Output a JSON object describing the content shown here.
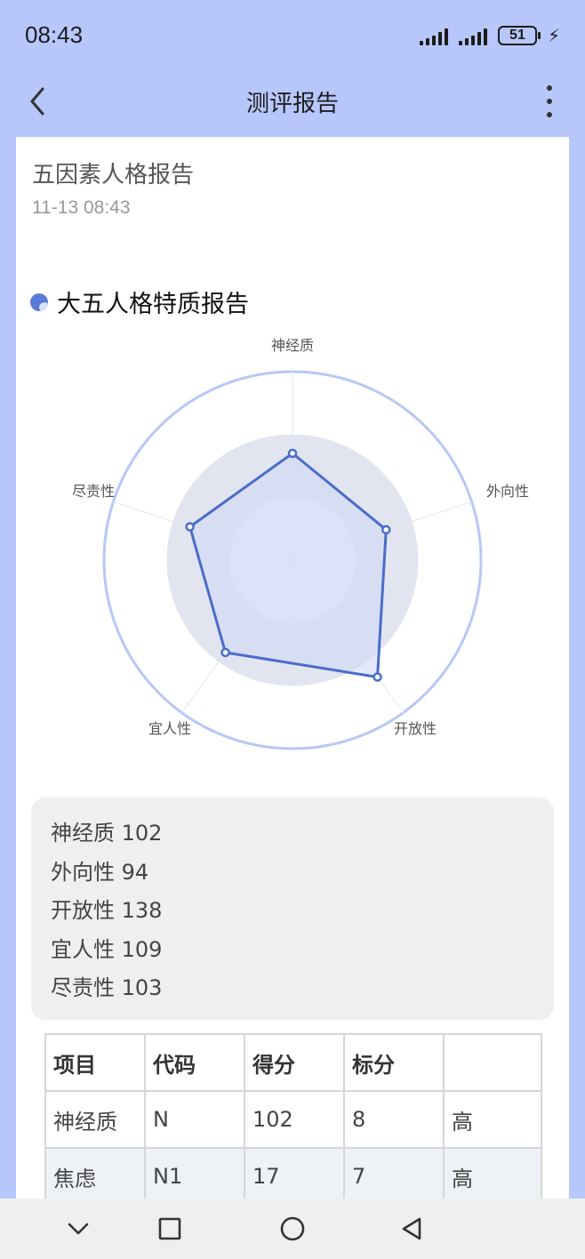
{
  "status_bar": {
    "time": "08:43",
    "battery": "51"
  },
  "app_bar": {
    "title": "测评报告"
  },
  "report": {
    "title": "五因素人格报告",
    "time": "11-13 08:43"
  },
  "section": {
    "title": "大五人格特质报告"
  },
  "chart_data": {
    "type": "radar",
    "indicators": [
      "神经质",
      "外向性",
      "开放性",
      "宜人性",
      "尽责性"
    ],
    "values": [
      102,
      94,
      138,
      109,
      103
    ],
    "colors": {
      "line": "#4a6dc8",
      "fill": "#cdd7f6",
      "outer_ring": "#b6c8f4"
    }
  },
  "scores": [
    "神经质 102",
    "外向性 94",
    "开放性 138",
    "宜人性 109",
    "尽责性 103"
  ],
  "table": {
    "headers": [
      "项目",
      "代码",
      "得分",
      "标分",
      ""
    ],
    "rows": [
      [
        "神经质",
        "N",
        "102",
        "8",
        "高"
      ],
      [
        "焦虑",
        "N1",
        "17",
        "7",
        "高"
      ]
    ]
  },
  "nav": {
    "icons": [
      "chevron-down-icon",
      "square-icon",
      "circle-icon",
      "triangle-back-icon"
    ]
  }
}
